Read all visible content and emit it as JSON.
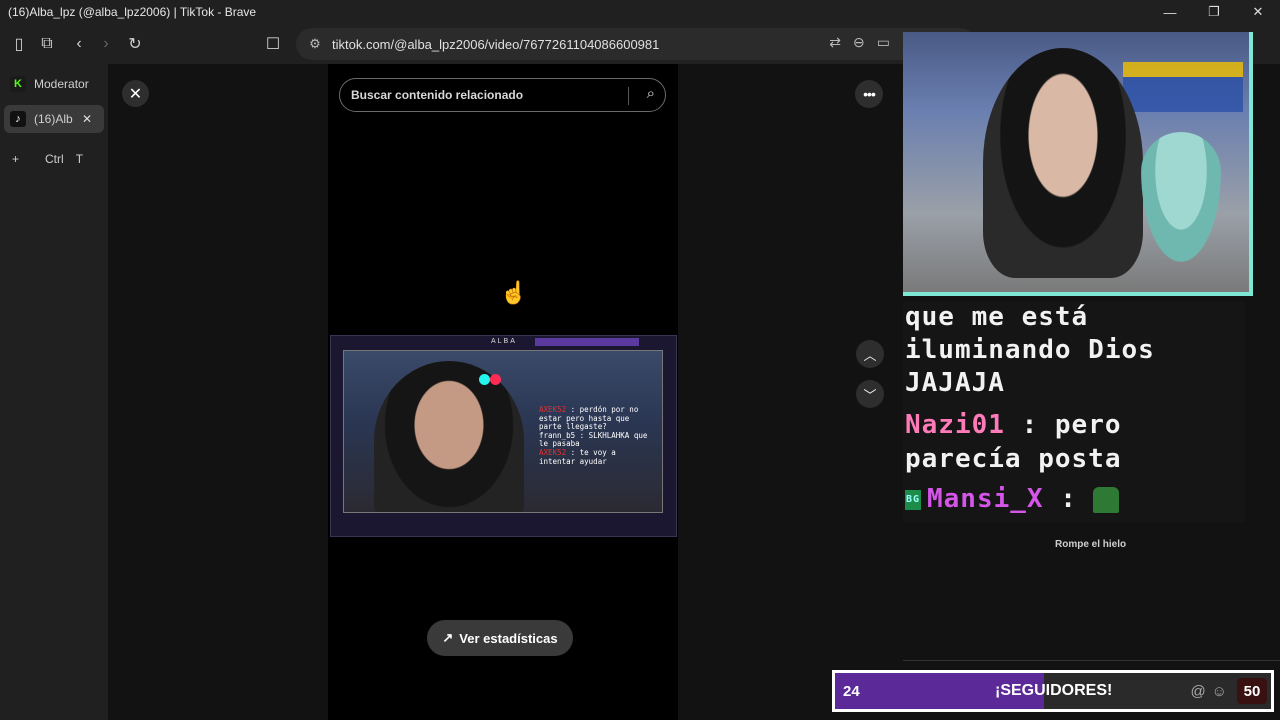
{
  "window": {
    "title": "(16)Alba_lpz (@alba_lpz2006) | TikTok - Brave",
    "minimize": "—",
    "restore": "❐",
    "close": "✕"
  },
  "toolbar": {
    "url": "tiktok.com/@alba_lpz2006/video/7677261104086600981",
    "icons": [
      "sidebar-icon",
      "tab-search-icon",
      "back-icon",
      "forward-icon",
      "reload-icon",
      "bookmark-icon",
      "site-info-icon",
      "translate-icon",
      "zoom-icon",
      "cast-icon"
    ]
  },
  "sidebar": {
    "tabs": [
      {
        "label": "Moderator",
        "favicon": "K"
      },
      {
        "label": "(16)Alb",
        "favicon": "♪",
        "close": "✕"
      }
    ],
    "new_tab_plus": "+",
    "new_tab_shortcut_ctrl": "Ctrl",
    "new_tab_shortcut_key": "T"
  },
  "page": {
    "close": "✕",
    "search_placeholder": "Buscar contenido relacionado",
    "more": "•••",
    "nav_up": "︿",
    "nav_down": "﹀",
    "stats_button": "Ver estadísticas",
    "stats_icon": "↗"
  },
  "embedded_stream": {
    "brand": "ALBA",
    "chat": [
      {
        "user": "AXEK52",
        "text": ": perdón por no estar pero hasta que parte llegaste?"
      },
      {
        "user": "frann_b5",
        "text": ": SLKHLAHKA que le pasaba"
      },
      {
        "user": "AXEK52",
        "text": ": te voy a intentar ayudar"
      }
    ]
  },
  "overlay": {
    "chat_lines": [
      {
        "text": "que me está"
      },
      {
        "text": "iluminando Dios"
      },
      {
        "text": "JAJAJA"
      }
    ],
    "msg1_user": "Nazi01",
    "msg1_sep": ":",
    "msg1_text": "pero",
    "msg1_cont": "parecía posta",
    "msg2_badge": "BG",
    "msg2_user": "Mansi_X",
    "msg2_sep": ":",
    "icebreaker": "Rompe el hielo",
    "goal": {
      "current": "24",
      "label": "¡SEGUIDORES!",
      "target": "50",
      "progress": 0.48
    }
  },
  "colors": {
    "accent_purple": "#5b2a98",
    "webcam_border": "#7ee8d4",
    "user_pink": "#ff7ab8",
    "user_magenta": "#d455e8"
  }
}
